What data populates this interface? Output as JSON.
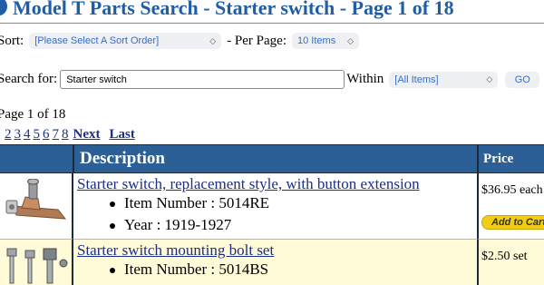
{
  "page": {
    "title": "Model T Parts Search - Starter switch - Page 1 of 18"
  },
  "sort": {
    "label": "Sort:",
    "value": "[Please Select A Sort Order]",
    "per_page_label": "- Per Page:",
    "per_page_value": "10 Items"
  },
  "search": {
    "label": "Search for:",
    "value": "Starter switch",
    "within_label": "Within",
    "within_value": "[All Items]",
    "go_label": "GO"
  },
  "pagination": {
    "summary": "Page 1 of 18",
    "pages": [
      "2",
      "3",
      "4",
      "5",
      "6",
      "7",
      "8"
    ],
    "next_label": "Next",
    "last_label": "Last"
  },
  "table": {
    "columns": {
      "description": "Description",
      "price": "Price"
    },
    "rows": [
      {
        "title": "Starter switch, replacement style, with button extension",
        "specs": [
          "Item Number : 5014RE",
          "Year : 1919-1927"
        ],
        "price": "$36.95 each",
        "add_to_cart": "Add to Cart",
        "image_icon": "starter-switch-photo"
      },
      {
        "title": "Starter switch mounting bolt set",
        "specs": [
          "Item Number : 5014BS"
        ],
        "price": "$2.50 set",
        "image_icon": "bolt-set-photo"
      }
    ]
  },
  "colors": {
    "title": "#1f5ea6",
    "header_bg": "#2c5f95",
    "link": "#1b2f8a",
    "alt_row": "#fffad8",
    "add_to_cart": "#f1ce15"
  }
}
